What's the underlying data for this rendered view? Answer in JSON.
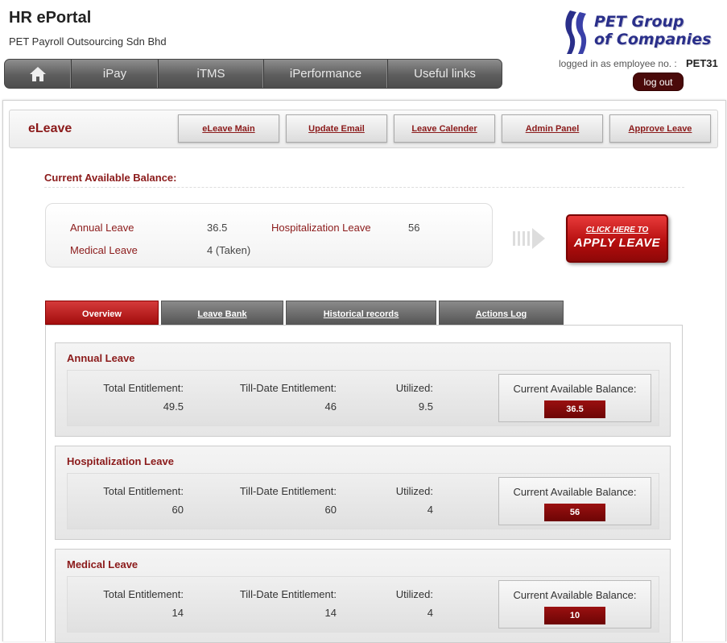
{
  "header": {
    "title": "HR ePortal",
    "subtitle": "PET Payroll Outsourcing Sdn Bhd",
    "logo_line1": "PET Group",
    "logo_line2": "of Companies",
    "login_label": "logged in as employee no. :",
    "employee_id": "PET31",
    "logout_label": "log out"
  },
  "nav": {
    "items": [
      {
        "label": "",
        "icon": "home-icon"
      },
      {
        "label": "iPay"
      },
      {
        "label": "iTMS"
      },
      {
        "label": "iPerformance"
      },
      {
        "label": "Useful links"
      }
    ]
  },
  "eleave": {
    "title": "eLeave",
    "buttons": [
      "eLeave Main",
      "Update Email",
      "Leave Calender",
      "Admin Panel",
      "Approve Leave"
    ]
  },
  "balance": {
    "heading": "Current Available Balance:",
    "items": [
      {
        "label": "Annual Leave",
        "value": "36.5"
      },
      {
        "label": "Hospitalization Leave",
        "value": "56"
      },
      {
        "label": "Medical Leave",
        "value": "4 (Taken)"
      }
    ],
    "apply_small": "CLICK HERE TO",
    "apply_big": "APPLY LEAVE"
  },
  "tabs": [
    "Overview",
    "Leave Bank",
    "Historical records",
    "Actions Log"
  ],
  "active_tab": "Overview",
  "labels": {
    "total": "Total Entitlement:",
    "till_date": "Till-Date Entitlement:",
    "utilized": "Utilized:",
    "current": "Current Available Balance:"
  },
  "cards": [
    {
      "title": "Annual Leave",
      "total": "49.5",
      "till_date": "46",
      "utilized": "9.5",
      "current": "36.5"
    },
    {
      "title": "Hospitalization Leave",
      "total": "60",
      "till_date": "60",
      "utilized": "4",
      "current": "56"
    },
    {
      "title": "Medical Leave",
      "total": "14",
      "till_date": "14",
      "utilized": "4",
      "current": "10"
    }
  ],
  "colors": {
    "accent": "#8b1a1a",
    "nav": "#5d5d5d",
    "button_red": "#b30d0d"
  }
}
